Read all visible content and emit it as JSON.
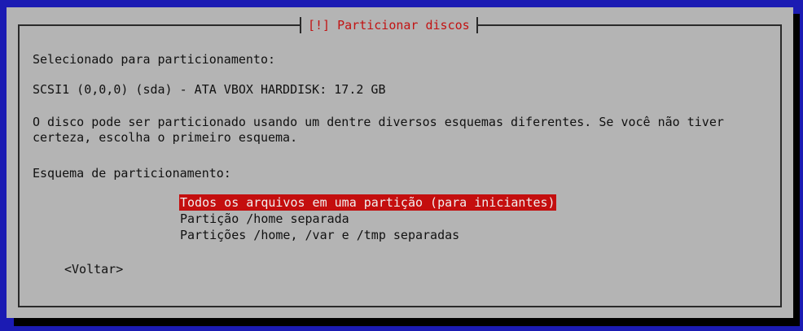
{
  "dialog": {
    "title": "[!] Particionar discos",
    "selected_label": "Selecionado para particionamento:",
    "disk": "SCSI1 (0,0,0) (sda) - ATA VBOX HARDDISK: 17.2 GB",
    "description": "O disco pode ser particionado usando um dentre diversos esquemas diferentes. Se você não tiver certeza, escolha o primeiro esquema.",
    "scheme_label": "Esquema de particionamento:",
    "options": [
      "Todos os arquivos em uma partição (para iniciantes)",
      "Partição /home separada",
      "Partições /home, /var e /tmp separadas"
    ],
    "selected_index": 0,
    "back_button": "<Voltar>"
  },
  "colors": {
    "background": "#1b1bb3",
    "dialog": "#b4b4b4",
    "title": "#c21313",
    "selection": "#c40e0e"
  }
}
